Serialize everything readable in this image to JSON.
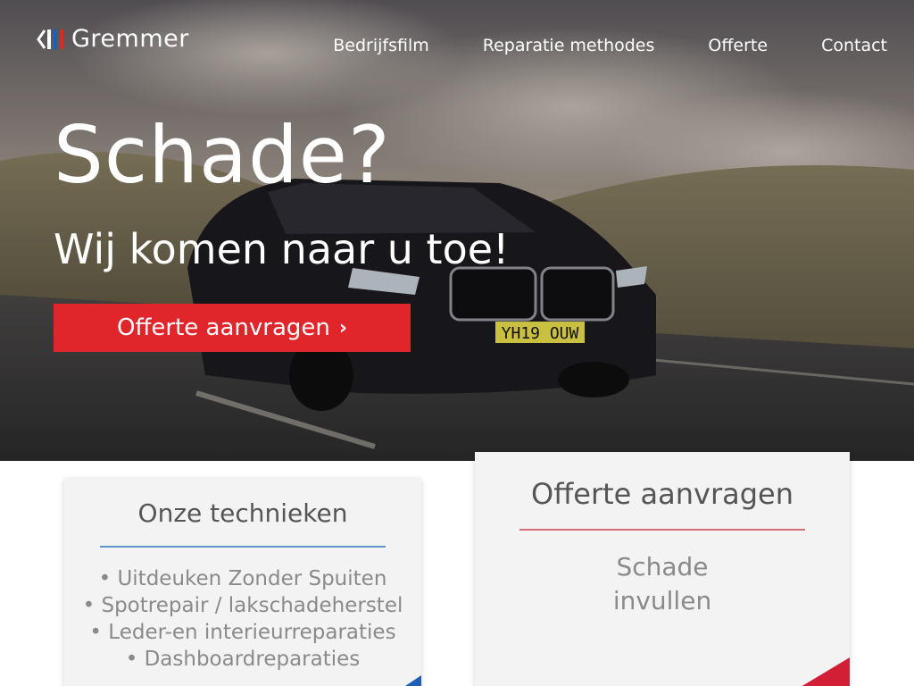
{
  "brand": {
    "name": "Gremmer",
    "logo_colors": [
      "#222222",
      "#1d5fb8",
      "#e0252b"
    ]
  },
  "nav": {
    "items": [
      {
        "label": "Bedrijfsfilm"
      },
      {
        "label": "Reparatie methodes"
      },
      {
        "label": "Offerte"
      },
      {
        "label": "Contact"
      }
    ]
  },
  "hero": {
    "headline": "Schade?",
    "subline": "Wij komen naar u toe!",
    "cta_label": "Offerte aanvragen",
    "cta_icon": "chevron-right-icon",
    "plate": "YH19 OUW"
  },
  "cards": {
    "techniques": {
      "title": "Onze technieken",
      "items": [
        "• Uitdeuken Zonder Spuiten",
        "• Spotrepair / lakschadeherstel",
        "• Leder-en interieurreparaties",
        "• Dashboardreparaties"
      ],
      "accent": "#1d5fb8"
    },
    "quote": {
      "title": "Offerte aanvragen",
      "line1": "Schade",
      "line2": "invullen",
      "accent": "#e0252b"
    }
  },
  "colors": {
    "cta": "#e0252b",
    "blue_accent": "#5f93cc",
    "red_accent": "#d96b7a"
  }
}
